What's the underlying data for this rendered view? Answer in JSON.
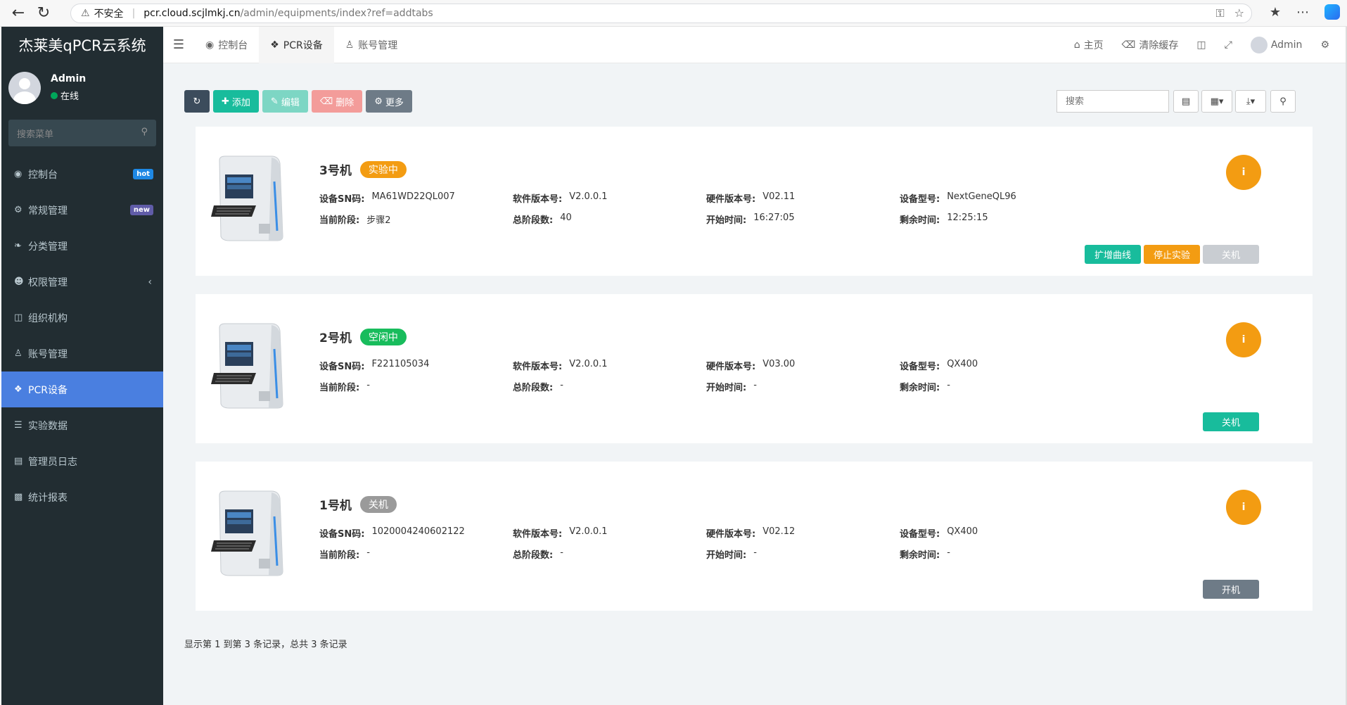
{
  "browser": {
    "security_label": "不安全",
    "url_host": "pcr.cloud.scjlmkj.cn",
    "url_path": "/admin/equipments/index?ref=addtabs"
  },
  "sidebar": {
    "brand": "杰莱美qPCR云系统",
    "user_name": "Admin",
    "user_status": "在线",
    "search_placeholder": "搜索菜单",
    "items": [
      {
        "label": "控制台",
        "badge": "hot",
        "icon": "dashboard-icon"
      },
      {
        "label": "常规管理",
        "badge": "new",
        "icon": "cogs-icon"
      },
      {
        "label": "分类管理",
        "icon": "leaf-icon"
      },
      {
        "label": "权限管理",
        "icon": "users-icon"
      },
      {
        "label": "组织机构",
        "icon": "sitemap-icon"
      },
      {
        "label": "账号管理",
        "icon": "user-icon"
      },
      {
        "label": "PCR设备",
        "icon": "cubes-icon"
      },
      {
        "label": "实验数据",
        "icon": "database-icon"
      },
      {
        "label": "管理员日志",
        "icon": "list-icon"
      },
      {
        "label": "统计报表",
        "icon": "chart-icon"
      }
    ]
  },
  "topbar": {
    "tabs": [
      {
        "label": "控制台"
      },
      {
        "label": "PCR设备"
      },
      {
        "label": "账号管理"
      }
    ],
    "home": "主页",
    "clear_cache": "清除缓存",
    "admin": "Admin"
  },
  "toolbar": {
    "add": "添加",
    "edit": "编辑",
    "delete": "删除",
    "more": "更多",
    "search_placeholder": "搜索"
  },
  "labels": {
    "sn": "设备SN码:",
    "software": "软件版本号:",
    "hardware": "硬件版本号:",
    "model": "设备型号:",
    "stage": "当前阶段:",
    "total": "总阶段数:",
    "start": "开始时间:",
    "remaining": "剩余时间:"
  },
  "devices": [
    {
      "name": "3号机",
      "status": "实验中",
      "status_color": "#f39c12",
      "sn": "MA61WD22QL007",
      "software": "V2.0.0.1",
      "hardware": "V02.11",
      "model": "NextGeneQL96",
      "stage": "步骤2",
      "total": "40",
      "start": "16:27:05",
      "remaining": "12:25:15",
      "actions": [
        {
          "label": "扩增曲线",
          "color": "#18bc9c"
        },
        {
          "label": "停止实验",
          "color": "#f39c12"
        },
        {
          "label": "关机",
          "color": "#c9cdd2"
        }
      ]
    },
    {
      "name": "2号机",
      "status": "空闲中",
      "status_color": "#18bc5c",
      "sn": "F221105034",
      "software": "V2.0.0.1",
      "hardware": "V03.00",
      "model": "QX400",
      "stage": "-",
      "total": "-",
      "start": "-",
      "remaining": "-",
      "actions": [
        {
          "label": "关机",
          "color": "#18bc9c"
        }
      ]
    },
    {
      "name": "1号机",
      "status": "关机",
      "status_color": "#9a9a9a",
      "sn": "1020004240602122",
      "software": "V2.0.0.1",
      "hardware": "V02.12",
      "model": "QX400",
      "stage": "-",
      "total": "-",
      "start": "-",
      "remaining": "-",
      "actions": [
        {
          "label": "开机",
          "color": "#6e7b87"
        }
      ]
    }
  ],
  "pager": "显示第 1 到第 3 条记录，总共 3 条记录"
}
